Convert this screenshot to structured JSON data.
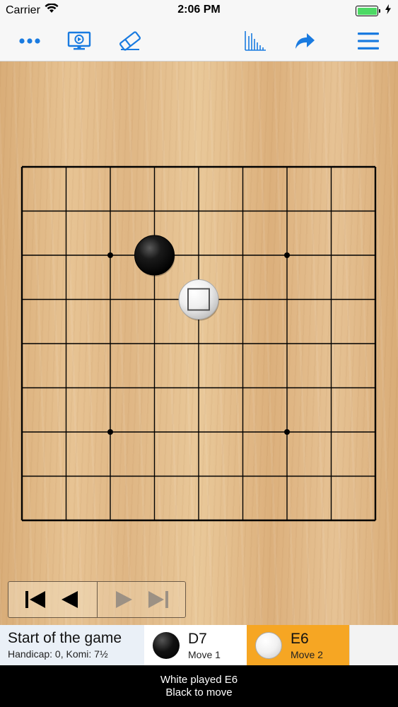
{
  "status_bar": {
    "carrier": "Carrier",
    "time": "2:06 PM",
    "battery_level": 1.0
  },
  "toolbar": {
    "left_icons": [
      "more-icon",
      "screen-icon",
      "eraser-icon"
    ],
    "right_icons": [
      "chart-icon",
      "share-icon",
      "menu-icon"
    ],
    "accent_color": "#1a7be0"
  },
  "board": {
    "size": 9,
    "star_points": [
      "C7",
      "G7",
      "C3",
      "G3"
    ],
    "stones": [
      {
        "color": "black",
        "point": "D7",
        "move": 1
      },
      {
        "color": "white",
        "point": "E6",
        "move": 2,
        "last_move": true
      }
    ]
  },
  "navigation": {
    "buttons": [
      "first-move",
      "previous-move",
      "next-move",
      "last-move"
    ],
    "enabled": [
      true,
      true,
      false,
      false
    ]
  },
  "move_list": {
    "start_title": "Start of the game",
    "start_subtitle": "Handicap: 0, Komi: 7½",
    "moves": [
      {
        "coord": "D7",
        "label": "Move 1",
        "color": "black"
      },
      {
        "coord": "E6",
        "label": "Move 2",
        "color": "white"
      }
    ],
    "current_color": "#f6a623"
  },
  "footer": {
    "line1": "White played E6",
    "line2": "Black to move"
  }
}
